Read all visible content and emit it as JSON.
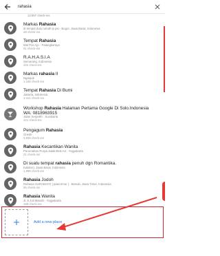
{
  "search": {
    "query": "rahasia"
  },
  "results": [
    {
      "title_pre": "",
      "title_hl": "",
      "title_post": "",
      "subtitle": "13.867 check-ins",
      "icon": "pin-icon"
    },
    {
      "title_pre": "Markas ",
      "title_hl": "Rahasia",
      "title_post": "",
      "subtitle": "di tempat dulu rumah ip psi - Bogor, Jawa Barat, Indonesia",
      "count": "28 check-ins",
      "icon": "pin-icon"
    },
    {
      "title_pre": "Tempat ",
      "title_hl": "Rahasia",
      "title_post": "",
      "subtitle": "Mal Pos Ajo · Palangkaraya",
      "count": "61 check-ins",
      "icon": "pin-icon"
    },
    {
      "title_pre": "R.A.H.A.S.I.A",
      "title_hl": "",
      "title_post": "",
      "subtitle": "Semarang, Indonesia",
      "count": "431 check-ins",
      "icon": "pin-icon"
    },
    {
      "title_pre": "Markas ",
      "title_hl": "rahasia",
      "title_post": " II",
      "subtitle": "Nganjuk",
      "count": "1,156 check-ins",
      "icon": "pin-icon"
    },
    {
      "title_pre": "Tempat ",
      "title_hl": "Rahasia",
      "title_post": " Di Bumi",
      "subtitle": "Jakarta, Indonesia",
      "count": "1,221 check-ins",
      "icon": "pin-icon"
    },
    {
      "title_pre": "Workshop ",
      "title_hl": "Rahasia",
      "title_post": " Halaman Pertama Google Di Solo.Indonesia",
      "subtitle": "WA: 0818963915",
      "count": "Jalan Serpetth · Surakarta",
      "count2": "421 check-ins",
      "icon": "bar-icon"
    },
    {
      "title_pre": "Pengagum ",
      "title_hl": "Rahasia",
      "title_post": "",
      "subtitle": "Gresik",
      "count": "3,936 check-ins",
      "icon": "pin-icon"
    },
    {
      "title_pre": "",
      "title_hl": "Rahasia",
      "title_post": " Kecantikan Wanita",
      "subtitle": "Perumahan Purpa Jalak Blok A3 · Yogyakarta",
      "count": "21 check-ins",
      "icon": "pin-icon"
    },
    {
      "title_pre": "Di suatu tempat ",
      "title_hl": "rahasia",
      "title_post": " penuh dgn Romantika.",
      "subtitle": "Kalidoro, Jawa Barat, Indonesia",
      "count": "1,998 check-ins",
      "icon": "pin-icon"
    },
    {
      "title_pre": "",
      "title_hl": "Rahasia",
      "title_post": " Jodoh",
      "subtitle": "Rahasia SURABAYO | pawi timur | · Besuki, Jawa Timur, Indonesia",
      "count": "65 check-ins",
      "icon": "pin-icon"
    },
    {
      "title_pre": "",
      "title_hl": "Rahasia",
      "title_post": " Wanita",
      "subtitle": "Jl. 9 Juli Manah · Yogyakarta",
      "count": "188 check-ins",
      "icon": "pin-icon"
    }
  ],
  "add_place": {
    "label": "Add a new place",
    "icon": "plus-icon"
  },
  "colors": {
    "accent_red": "#c62828",
    "link_blue": "#1a73e8",
    "pin_gray": "#646464"
  }
}
